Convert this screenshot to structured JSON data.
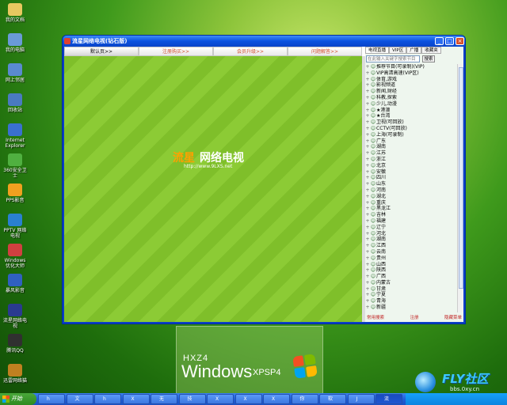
{
  "desktop": {
    "icons": [
      {
        "label": "我的文档",
        "icon": "folder-icon",
        "color": "#e8c860"
      },
      {
        "label": "我的电脑",
        "icon": "computer-icon",
        "color": "#6a9ad8"
      },
      {
        "label": "网上邻居",
        "icon": "network-icon",
        "color": "#5a8ad0"
      },
      {
        "label": "回收站",
        "icon": "recycle-bin-icon",
        "color": "#4a7ac0"
      },
      {
        "label": "Internet Explorer",
        "icon": "ie-icon",
        "color": "#3a70d0"
      },
      {
        "label": "360安全卫士",
        "icon": "shield-icon",
        "color": "#50b040"
      },
      {
        "label": "PPS影音",
        "icon": "pps-icon",
        "color": "#f0a020"
      },
      {
        "label": "PPTV 网络电视",
        "icon": "pptv-icon",
        "color": "#2a80d0"
      },
      {
        "label": "Windows 优化大师",
        "icon": "optimizer-icon",
        "color": "#d04040"
      },
      {
        "label": "暴风影音",
        "icon": "storm-icon",
        "color": "#3060c0"
      },
      {
        "label": "流星网络电视",
        "icon": "meteor-icon",
        "color": "#2a3a90"
      },
      {
        "label": "腾讯QQ",
        "icon": "qq-icon",
        "color": "#303030"
      },
      {
        "label": "迅雷网络猫",
        "icon": "cat-icon",
        "color": "#c08020"
      }
    ]
  },
  "brand": {
    "prefix": "HXZ4",
    "windows": "Windows",
    "edition": "XPSP4"
  },
  "window": {
    "title": "流星网络电视(钻石版)",
    "controls": {
      "minimize": "_",
      "maximize": "□",
      "close": "×"
    },
    "tabs": [
      "默认页>>",
      "注册购买>>",
      "会员升级>>",
      "问题解答>>"
    ],
    "video": {
      "logo_a": "流星",
      "logo_b": "网络电视",
      "url": "http://www.9LXS.net"
    },
    "sidebar": {
      "tabs": [
        "电视直播",
        "VIP区",
        "广播",
        "收藏夹"
      ],
      "search_placeholder": "在此输入关键字搜索节目",
      "search_button": "搜索",
      "channels": [
        "推荐节目(可录制)(VIP)",
        "VIP高清高速(VIP区)",
        "体育,游戏",
        "影视频道",
        "新闻,财经",
        "科教,探索",
        "少儿,动漫",
        "★港澳",
        "★台湾",
        "卫视(可回放)",
        "CCTV(可回放)",
        "上海(可录制)",
        "广东",
        "湖南",
        "江苏",
        "浙江",
        "北京",
        "安徽",
        "四川",
        "山东",
        "河南",
        "湖北",
        "重庆",
        "黑龙江",
        "吉林",
        "福建",
        "辽宁",
        "河北",
        "湖南",
        "江西",
        "云南",
        "贵州",
        "山西",
        "陕西",
        "广西",
        "内蒙古",
        "甘肃",
        "宁夏",
        "青海",
        "新疆"
      ],
      "footer": {
        "left": "常用搜索",
        "mid": "注册",
        "right": "隐藏菜单"
      }
    }
  },
  "taskbar": {
    "start_label": "开始",
    "tasks": [
      "h",
      "文",
      "h",
      "X",
      "无",
      "技",
      "X",
      "X",
      "X",
      "你",
      "软",
      "J",
      "流"
    ]
  },
  "watermark": {
    "name": "FLY社区",
    "site": "bbs.0xy.cn"
  }
}
